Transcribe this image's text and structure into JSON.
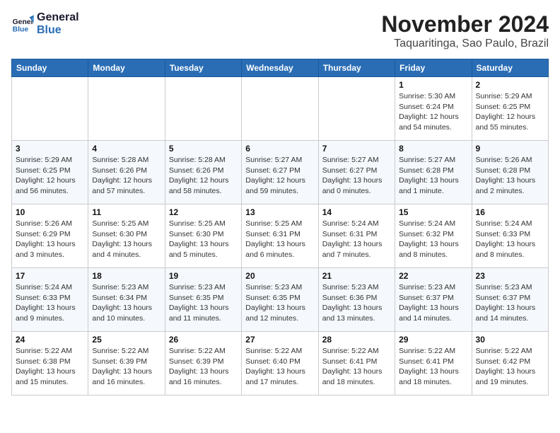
{
  "logo": {
    "line1": "General",
    "line2": "Blue"
  },
  "title": "November 2024",
  "location": "Taquaritinga, Sao Paulo, Brazil",
  "weekdays": [
    "Sunday",
    "Monday",
    "Tuesday",
    "Wednesday",
    "Thursday",
    "Friday",
    "Saturday"
  ],
  "weeks": [
    [
      {
        "day": "",
        "info": ""
      },
      {
        "day": "",
        "info": ""
      },
      {
        "day": "",
        "info": ""
      },
      {
        "day": "",
        "info": ""
      },
      {
        "day": "",
        "info": ""
      },
      {
        "day": "1",
        "info": "Sunrise: 5:30 AM\nSunset: 6:24 PM\nDaylight: 12 hours and 54 minutes."
      },
      {
        "day": "2",
        "info": "Sunrise: 5:29 AM\nSunset: 6:25 PM\nDaylight: 12 hours and 55 minutes."
      }
    ],
    [
      {
        "day": "3",
        "info": "Sunrise: 5:29 AM\nSunset: 6:25 PM\nDaylight: 12 hours and 56 minutes."
      },
      {
        "day": "4",
        "info": "Sunrise: 5:28 AM\nSunset: 6:26 PM\nDaylight: 12 hours and 57 minutes."
      },
      {
        "day": "5",
        "info": "Sunrise: 5:28 AM\nSunset: 6:26 PM\nDaylight: 12 hours and 58 minutes."
      },
      {
        "day": "6",
        "info": "Sunrise: 5:27 AM\nSunset: 6:27 PM\nDaylight: 12 hours and 59 minutes."
      },
      {
        "day": "7",
        "info": "Sunrise: 5:27 AM\nSunset: 6:27 PM\nDaylight: 13 hours and 0 minutes."
      },
      {
        "day": "8",
        "info": "Sunrise: 5:27 AM\nSunset: 6:28 PM\nDaylight: 13 hours and 1 minute."
      },
      {
        "day": "9",
        "info": "Sunrise: 5:26 AM\nSunset: 6:28 PM\nDaylight: 13 hours and 2 minutes."
      }
    ],
    [
      {
        "day": "10",
        "info": "Sunrise: 5:26 AM\nSunset: 6:29 PM\nDaylight: 13 hours and 3 minutes."
      },
      {
        "day": "11",
        "info": "Sunrise: 5:25 AM\nSunset: 6:30 PM\nDaylight: 13 hours and 4 minutes."
      },
      {
        "day": "12",
        "info": "Sunrise: 5:25 AM\nSunset: 6:30 PM\nDaylight: 13 hours and 5 minutes."
      },
      {
        "day": "13",
        "info": "Sunrise: 5:25 AM\nSunset: 6:31 PM\nDaylight: 13 hours and 6 minutes."
      },
      {
        "day": "14",
        "info": "Sunrise: 5:24 AM\nSunset: 6:31 PM\nDaylight: 13 hours and 7 minutes."
      },
      {
        "day": "15",
        "info": "Sunrise: 5:24 AM\nSunset: 6:32 PM\nDaylight: 13 hours and 8 minutes."
      },
      {
        "day": "16",
        "info": "Sunrise: 5:24 AM\nSunset: 6:33 PM\nDaylight: 13 hours and 8 minutes."
      }
    ],
    [
      {
        "day": "17",
        "info": "Sunrise: 5:24 AM\nSunset: 6:33 PM\nDaylight: 13 hours and 9 minutes."
      },
      {
        "day": "18",
        "info": "Sunrise: 5:23 AM\nSunset: 6:34 PM\nDaylight: 13 hours and 10 minutes."
      },
      {
        "day": "19",
        "info": "Sunrise: 5:23 AM\nSunset: 6:35 PM\nDaylight: 13 hours and 11 minutes."
      },
      {
        "day": "20",
        "info": "Sunrise: 5:23 AM\nSunset: 6:35 PM\nDaylight: 13 hours and 12 minutes."
      },
      {
        "day": "21",
        "info": "Sunrise: 5:23 AM\nSunset: 6:36 PM\nDaylight: 13 hours and 13 minutes."
      },
      {
        "day": "22",
        "info": "Sunrise: 5:23 AM\nSunset: 6:37 PM\nDaylight: 13 hours and 14 minutes."
      },
      {
        "day": "23",
        "info": "Sunrise: 5:23 AM\nSunset: 6:37 PM\nDaylight: 13 hours and 14 minutes."
      }
    ],
    [
      {
        "day": "24",
        "info": "Sunrise: 5:22 AM\nSunset: 6:38 PM\nDaylight: 13 hours and 15 minutes."
      },
      {
        "day": "25",
        "info": "Sunrise: 5:22 AM\nSunset: 6:39 PM\nDaylight: 13 hours and 16 minutes."
      },
      {
        "day": "26",
        "info": "Sunrise: 5:22 AM\nSunset: 6:39 PM\nDaylight: 13 hours and 16 minutes."
      },
      {
        "day": "27",
        "info": "Sunrise: 5:22 AM\nSunset: 6:40 PM\nDaylight: 13 hours and 17 minutes."
      },
      {
        "day": "28",
        "info": "Sunrise: 5:22 AM\nSunset: 6:41 PM\nDaylight: 13 hours and 18 minutes."
      },
      {
        "day": "29",
        "info": "Sunrise: 5:22 AM\nSunset: 6:41 PM\nDaylight: 13 hours and 18 minutes."
      },
      {
        "day": "30",
        "info": "Sunrise: 5:22 AM\nSunset: 6:42 PM\nDaylight: 13 hours and 19 minutes."
      }
    ]
  ]
}
